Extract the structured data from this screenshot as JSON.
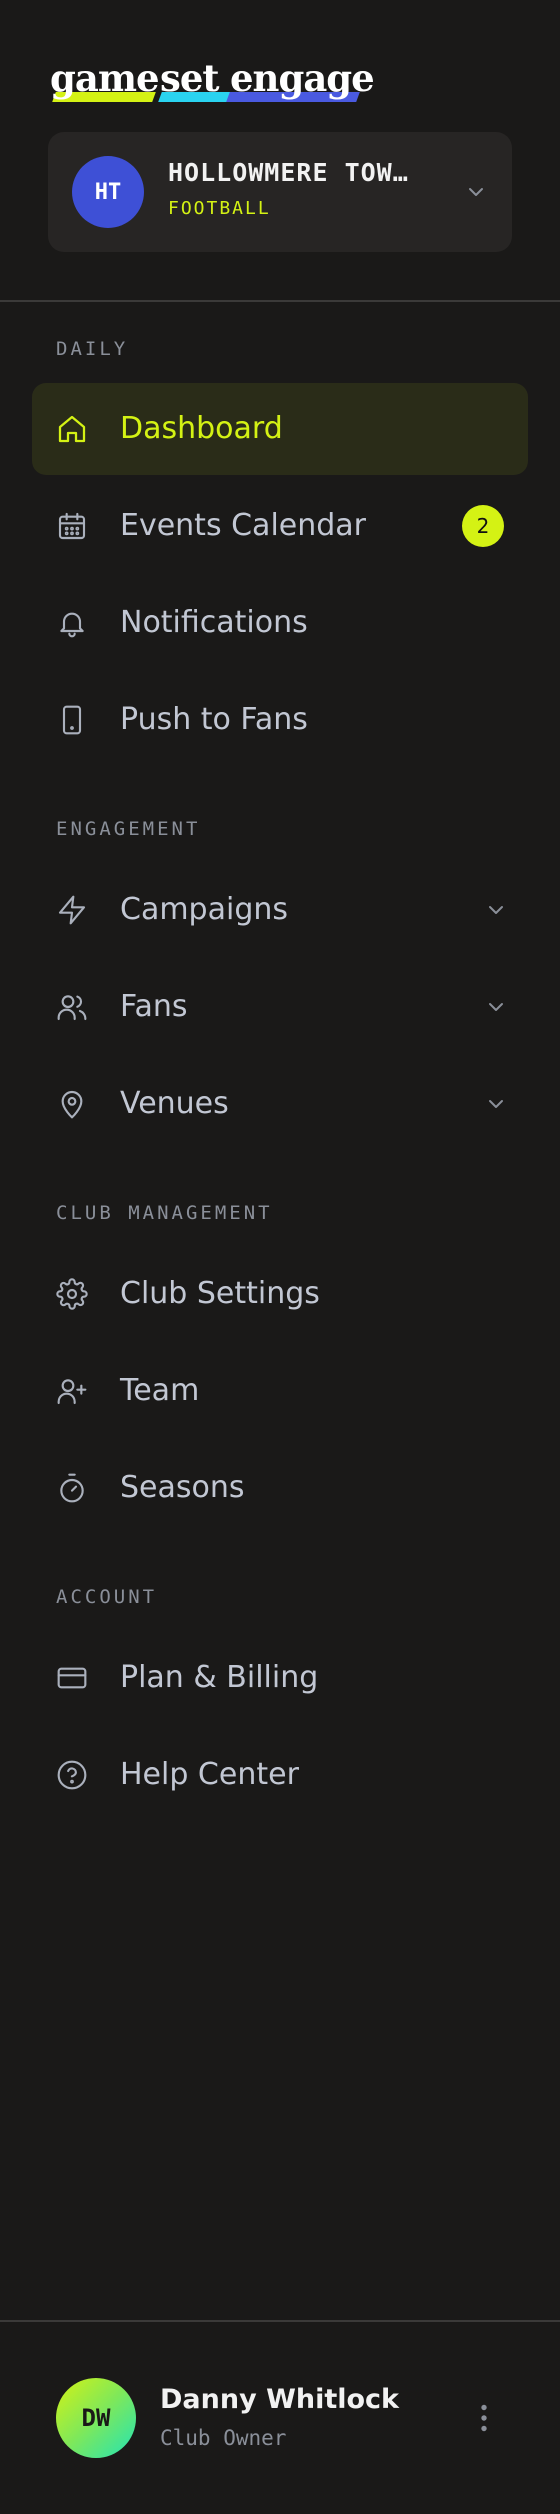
{
  "brand": {
    "words": [
      "game",
      "set",
      "engage"
    ],
    "colors": [
      "#d4f214",
      "#2ad3f0",
      "#4a5ae0"
    ]
  },
  "club": {
    "initials": "HT",
    "name": "HOLLOWMERE TOWN…",
    "sport": "FOOTBALL",
    "avatar_color": "#3e50d6",
    "chevron_icon": "chevron-down-icon"
  },
  "theme": {
    "accent": "#d4f214",
    "background": "#1a1918",
    "text": "#c2c7d3",
    "muted": "#8a8f99"
  },
  "nav": {
    "daily": {
      "title": "DAILY",
      "items": [
        {
          "label": "Dashboard",
          "icon": "home-icon",
          "active": true
        },
        {
          "label": "Events Calendar",
          "icon": "calendar-icon",
          "badge": "2"
        },
        {
          "label": "Notifications",
          "icon": "bell-icon"
        },
        {
          "label": "Push to Fans",
          "icon": "smartphone-icon"
        }
      ]
    },
    "engagement": {
      "title": "ENGAGEMENT",
      "items": [
        {
          "label": "Campaigns",
          "icon": "lightning-icon",
          "expandable": true
        },
        {
          "label": "Fans",
          "icon": "users-icon",
          "expandable": true
        },
        {
          "label": "Venues",
          "icon": "map-pin-icon",
          "expandable": true
        }
      ]
    },
    "club_management": {
      "title": "CLUB MANAGEMENT",
      "items": [
        {
          "label": "Club Settings",
          "icon": "gear-icon"
        },
        {
          "label": "Team",
          "icon": "user-plus-icon"
        },
        {
          "label": "Seasons",
          "icon": "timer-icon"
        }
      ]
    },
    "account": {
      "title": "ACCOUNT",
      "items": [
        {
          "label": "Plan & Billing",
          "icon": "credit-card-icon"
        },
        {
          "label": "Help Center",
          "icon": "help-circle-icon"
        }
      ]
    }
  },
  "user": {
    "initials": "DW",
    "name": "Danny Whitlock",
    "role": "Club Owner",
    "menu_icon": "more-vertical-icon"
  }
}
